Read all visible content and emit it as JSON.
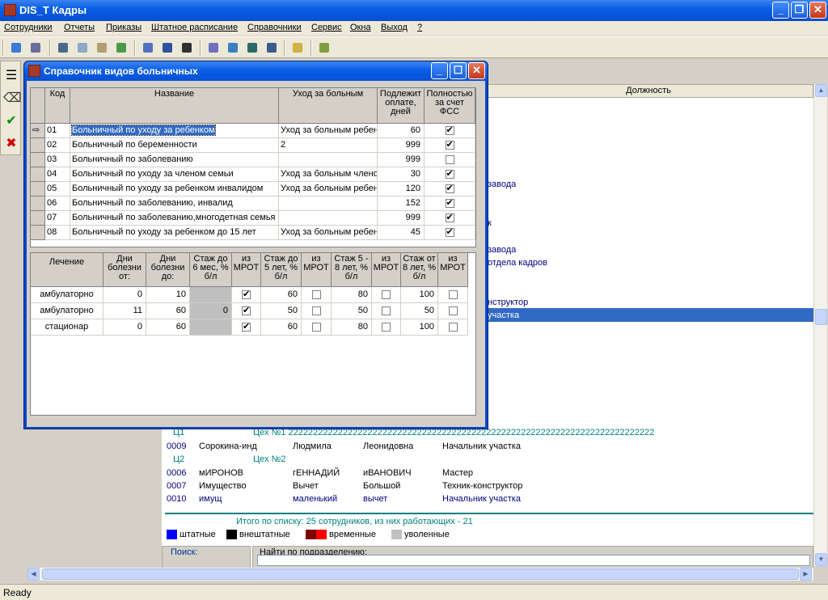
{
  "app": {
    "title": "DIS_T Кадры",
    "window_buttons": [
      "_",
      "❐",
      "✕"
    ]
  },
  "menu": [
    "Сотрудники",
    "Отчеты",
    "Приказы",
    "Штатное расписание",
    "Справочники",
    "Сервис",
    "Окна",
    "Выход",
    "?"
  ],
  "toolbar": {
    "icons": [
      "users-icon",
      "tools-icon",
      "search-person-icon",
      "calendar-icon",
      "palm-icon",
      "network-icon",
      "document-icon",
      "grid-icon",
      "filter-icon",
      "edit-icon",
      "sheet-icon",
      "table-icon",
      "help-icon",
      "exit-icon"
    ]
  },
  "vtoolbar": {
    "icons": [
      "list-icon",
      "eraser-icon",
      "check-icon",
      "cross-icon"
    ],
    "glyphs": [
      "☰",
      "⌫",
      "✔",
      "✖"
    ]
  },
  "dialog": {
    "title": "Справочник видов больничных",
    "buttons": [
      "_",
      "☐",
      "✕"
    ],
    "top_table": {
      "headers": [
        "Код",
        "Название",
        "Уход за больным",
        "Подлежит оплате, дней",
        "Полностью за счет ФСС"
      ],
      "rows": [
        {
          "code": "01",
          "name": "Больничный по уходу за ребенком",
          "care": "Уход за больным ребен",
          "days": "60",
          "fss": true
        },
        {
          "code": "02",
          "name": "Больничный по беременности",
          "care": "2",
          "days": "999",
          "fss": true
        },
        {
          "code": "03",
          "name": "Больничный по заболеванию",
          "care": "",
          "days": "999",
          "fss": false
        },
        {
          "code": "04",
          "name": "Больничный по уходу за членом семьи",
          "care": "Уход за больным члено",
          "days": "30",
          "fss": true
        },
        {
          "code": "05",
          "name": "Больничный по уходу за ребенком инвалидом",
          "care": "Уход за больным ребен",
          "days": "120",
          "fss": true
        },
        {
          "code": "06",
          "name": "Больничный по заболеванию, инвалид",
          "care": "",
          "days": "152",
          "fss": true
        },
        {
          "code": "07",
          "name": "Больничный по заболеванию,многодетная семья",
          "care": "",
          "days": "999",
          "fss": true
        },
        {
          "code": "08",
          "name": "Больничный по уходу за ребенком до 15 лет",
          "care": "Уход за больным ребен",
          "days": "45",
          "fss": true
        }
      ],
      "current_marker": "⇨"
    },
    "bottom_table": {
      "headers": [
        "Лечение",
        "Дни болезни от:",
        "Дни болезни до:",
        "Стаж до 6 мес, % б/л",
        "из МРОТ",
        "Стаж до 5 лет, % б/л",
        "из МРОТ",
        "Стаж 5 - 8 лет, % б/л",
        "из МРОТ",
        "Стаж от 8 лет, % б/л",
        "из МРОТ"
      ],
      "rows": [
        {
          "treatment": "амбулаторно",
          "from": "0",
          "to": "10",
          "s6": "",
          "m6": true,
          "s5": "60",
          "m5": false,
          "s58": "80",
          "m58": false,
          "s8": "100",
          "m8": false
        },
        {
          "treatment": "амбулаторно",
          "from": "11",
          "to": "60",
          "s6": "0",
          "m6": true,
          "s5": "50",
          "m5": false,
          "s58": "50",
          "m58": false,
          "s8": "50",
          "m8": false
        },
        {
          "treatment": "стационар",
          "from": "0",
          "to": "60",
          "s6": "",
          "m6": true,
          "s5": "60",
          "m5": false,
          "s58": "80",
          "m58": false,
          "s8": "100",
          "m8": false
        }
      ]
    }
  },
  "background": {
    "column_header": "Должность",
    "fragments": [
      "завода",
      "к",
      "завода",
      "отдела кадров",
      "нструктор",
      "участка"
    ],
    "dept_c1": {
      "code": "Ц1",
      "name": "Цех №1 22222222222222222222222222222222222222222222222222222222222222222222222222"
    },
    "dept_c2": {
      "code": "Ц2",
      "name": "Цех №2"
    },
    "employees": [
      {
        "id": "0009",
        "last": "Сорокина-инд",
        "first": "Людмила",
        "middle": "Леонидовна",
        "position": "Начальник участка"
      },
      {
        "id": "0006",
        "last": "мИРОНОВ",
        "first": "гЕННАДИЙ",
        "middle": "иВАНОВИЧ",
        "position": "Мастер"
      },
      {
        "id": "0007",
        "last": "Имущество",
        "first": "Вычет",
        "middle": "Большой",
        "position": "Техник-конструктор"
      },
      {
        "id": "0010",
        "last": "имущ",
        "first": "маленький",
        "middle": "вычет",
        "position": "Начальник участка"
      }
    ],
    "summary": "Итого по списку: 25 сотрудников, из них работающих - 21",
    "legend": [
      {
        "label": "штатные",
        "color": "#0000ff"
      },
      {
        "label": "внештатные",
        "color": "#000000"
      },
      {
        "label": "временные",
        "color": "#800000",
        "color2": "#ff0000"
      },
      {
        "label": "уволенные",
        "color": "#c0c0c0"
      }
    ],
    "search_label": "Поиск:",
    "find_by_dept_label": "Найти по подразделению:"
  },
  "status": "Ready"
}
